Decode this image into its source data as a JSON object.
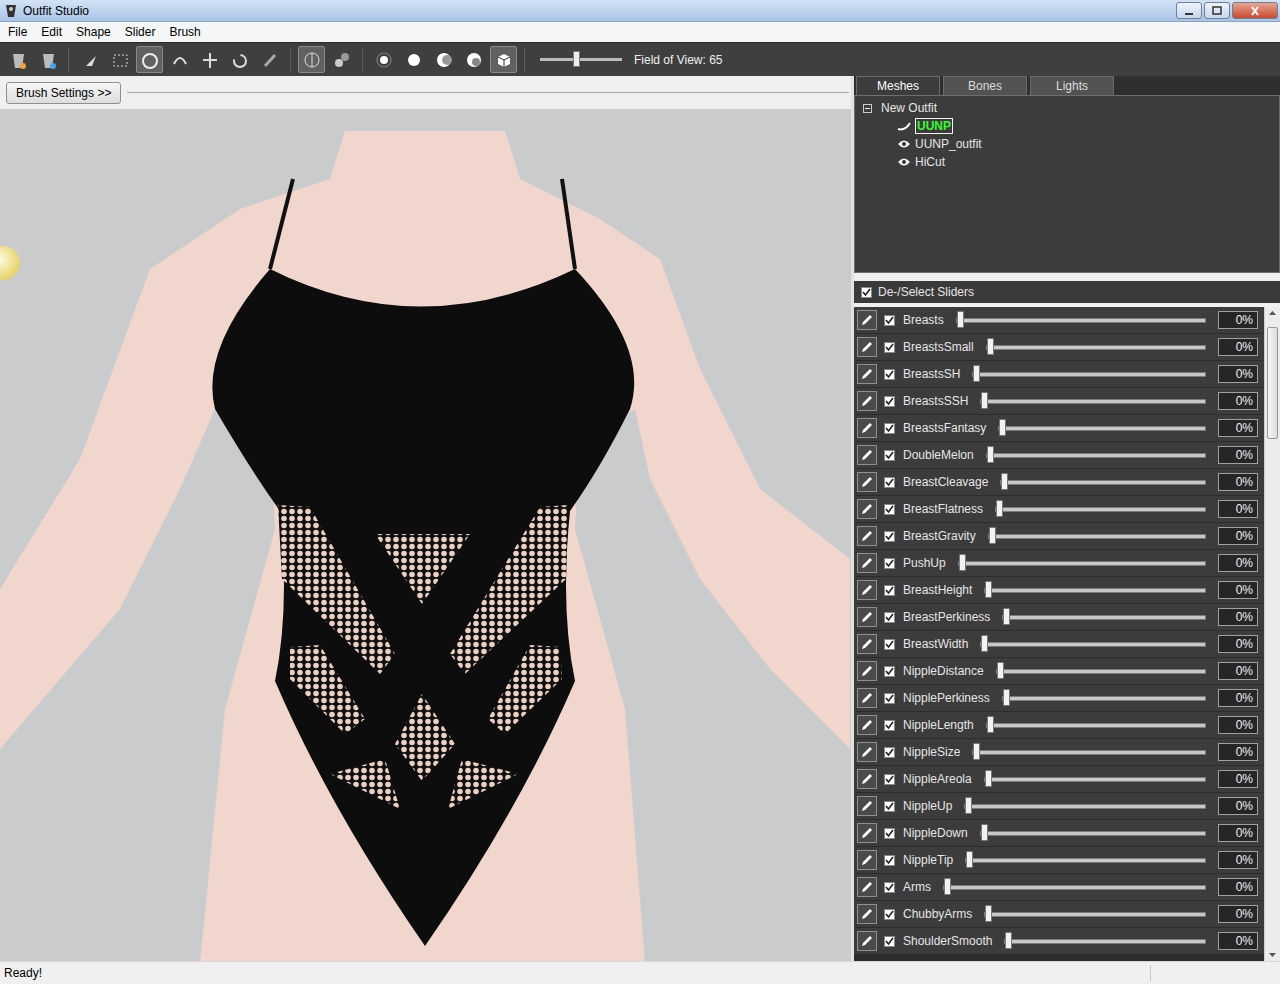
{
  "window": {
    "title": "Outfit Studio"
  },
  "menu": [
    "File",
    "Edit",
    "Shape",
    "Slider",
    "Brush"
  ],
  "toolbar": {
    "tools": [
      {
        "selected": false
      },
      {
        "selected": false
      },
      {
        "selected": false
      },
      {
        "selected": false
      },
      {
        "selected": true
      },
      {
        "selected": false
      },
      {
        "selected": false
      },
      {
        "selected": false
      },
      {
        "selected": false
      },
      {
        "selected": true
      },
      {
        "selected": false
      },
      {
        "selected": false
      },
      {
        "selected": false
      },
      {
        "selected": false
      },
      {
        "selected": false
      },
      {
        "selected": true
      }
    ],
    "fov": {
      "label": "Field of View: 65",
      "level": 0.44
    }
  },
  "brush_settings": {
    "label": "Brush Settings >>"
  },
  "tabs": [
    {
      "label": "Meshes",
      "selected": true
    },
    {
      "label": "Bones",
      "selected": false
    },
    {
      "label": "Lights",
      "selected": false
    }
  ],
  "tree": {
    "root": {
      "label": "New Outfit",
      "expanded": true
    },
    "items": [
      {
        "label": "UUNP",
        "kind": "reference",
        "selected": true
      },
      {
        "label": "UUNP_outfit",
        "kind": "shape",
        "selected": false
      },
      {
        "label": "HiCut",
        "kind": "shape",
        "selected": false
      }
    ]
  },
  "sliders": {
    "header": {
      "label": "De-/Select Sliders",
      "checked": true
    },
    "items": [
      {
        "name": "Breasts",
        "checked": true,
        "level": 0,
        "value": "0%"
      },
      {
        "name": "BreastsSmall",
        "checked": true,
        "level": 0,
        "value": "0%"
      },
      {
        "name": "BreastsSH",
        "checked": true,
        "level": 0,
        "value": "0%"
      },
      {
        "name": "BreastsSSH",
        "checked": true,
        "level": 0,
        "value": "0%"
      },
      {
        "name": "BreastsFantasy",
        "checked": true,
        "level": 0,
        "value": "0%"
      },
      {
        "name": "DoubleMelon",
        "checked": true,
        "level": 0,
        "value": "0%"
      },
      {
        "name": "BreastCleavage",
        "checked": true,
        "level": 0,
        "value": "0%"
      },
      {
        "name": "BreastFlatness",
        "checked": true,
        "level": 0,
        "value": "0%"
      },
      {
        "name": "BreastGravity",
        "checked": true,
        "level": 0,
        "value": "0%"
      },
      {
        "name": "PushUp",
        "checked": true,
        "level": 0,
        "value": "0%"
      },
      {
        "name": "BreastHeight",
        "checked": true,
        "level": 0,
        "value": "0%"
      },
      {
        "name": "BreastPerkiness",
        "checked": true,
        "level": 0,
        "value": "0%"
      },
      {
        "name": "BreastWidth",
        "checked": true,
        "level": 0,
        "value": "0%"
      },
      {
        "name": "NippleDistance",
        "checked": true,
        "level": 0,
        "value": "0%"
      },
      {
        "name": "NipplePerkiness",
        "checked": true,
        "level": 0,
        "value": "0%"
      },
      {
        "name": "NippleLength",
        "checked": true,
        "level": 0,
        "value": "0%"
      },
      {
        "name": "NippleSize",
        "checked": true,
        "level": 0,
        "value": "0%"
      },
      {
        "name": "NippleAreola",
        "checked": true,
        "level": 0,
        "value": "0%"
      },
      {
        "name": "NippleUp",
        "checked": true,
        "level": 0,
        "value": "0%"
      },
      {
        "name": "NippleDown",
        "checked": true,
        "level": 0,
        "value": "0%"
      },
      {
        "name": "NippleTip",
        "checked": true,
        "level": 0,
        "value": "0%"
      },
      {
        "name": "Arms",
        "checked": true,
        "level": 0,
        "value": "0%"
      },
      {
        "name": "ChubbyArms",
        "checked": true,
        "level": 0,
        "value": "0%"
      },
      {
        "name": "ShoulderSmooth",
        "checked": true,
        "level": 0,
        "value": "0%"
      }
    ]
  },
  "status_bar": "Ready!"
}
